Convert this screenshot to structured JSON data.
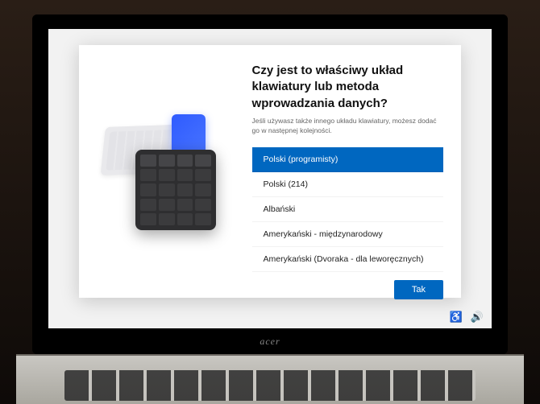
{
  "setup": {
    "title": "Czy jest to właściwy układ klawiatury lub metoda wprowadzania danych?",
    "subtitle": "Jeśli używasz także innego układu klawiatury, możesz dodać go w następnej kolejności.",
    "options": [
      "Polski (programisty)",
      "Polski (214)",
      "Albański",
      "Amerykański - międzynarodowy",
      "Amerykański (Dvoraka - dla leworęcznych)"
    ],
    "selected_index": 0,
    "yes_label": "Tak"
  },
  "tray": {
    "accessibility_icon": "♿",
    "volume_icon": "🔊"
  },
  "device": {
    "brand": "acer"
  },
  "colors": {
    "accent": "#0067c0"
  }
}
